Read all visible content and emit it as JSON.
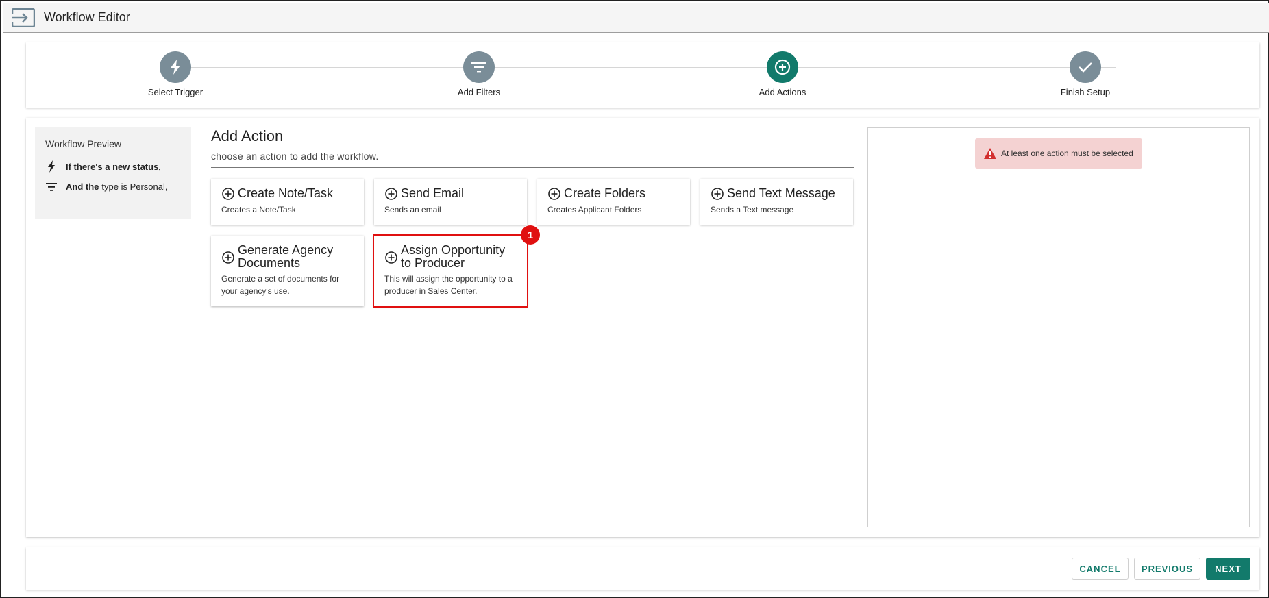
{
  "app": {
    "title": "Workflow Editor"
  },
  "stepper": {
    "steps": [
      {
        "label": "Select Trigger",
        "icon": "bolt-icon",
        "state": "done"
      },
      {
        "label": "Add Filters",
        "icon": "filter-icon",
        "state": "done"
      },
      {
        "label": "Add Actions",
        "icon": "plus-circle-icon",
        "state": "active"
      },
      {
        "label": "Finish Setup",
        "icon": "check-icon",
        "state": "pending"
      }
    ]
  },
  "preview": {
    "title": "Workflow Preview",
    "trigger_text": "If there's a new status,",
    "filter_bold": "And the",
    "filter_text": "type is Personal,"
  },
  "actions": {
    "heading": "Add Action",
    "subheading": "choose an action to add the workflow.",
    "items": [
      {
        "title": "Create Note/Task",
        "desc": "Creates a Note/Task"
      },
      {
        "title": "Send Email",
        "desc": "Sends an email"
      },
      {
        "title": "Create Folders",
        "desc": "Creates Applicant Folders"
      },
      {
        "title": "Send Text Message",
        "desc": "Sends a Text message"
      },
      {
        "title": "Generate Agency Documents",
        "desc": "Generate a set of documents for your agency's use."
      },
      {
        "title": "Assign Opportunity to Producer",
        "desc": "This will assign the opportunity to a producer in Sales Center."
      }
    ],
    "highlight_badge": "1"
  },
  "alert": {
    "text": "At least one action must be selected"
  },
  "footer": {
    "cancel_label": "CANCEL",
    "previous_label": "PREVIOUS",
    "next_label": "NEXT"
  },
  "colors": {
    "primary": "#127a6b",
    "step_inactive": "#7a8d98",
    "alert_bg": "#f4d2d2",
    "alert_icon": "#d32f2f",
    "highlight": "#e01010"
  }
}
